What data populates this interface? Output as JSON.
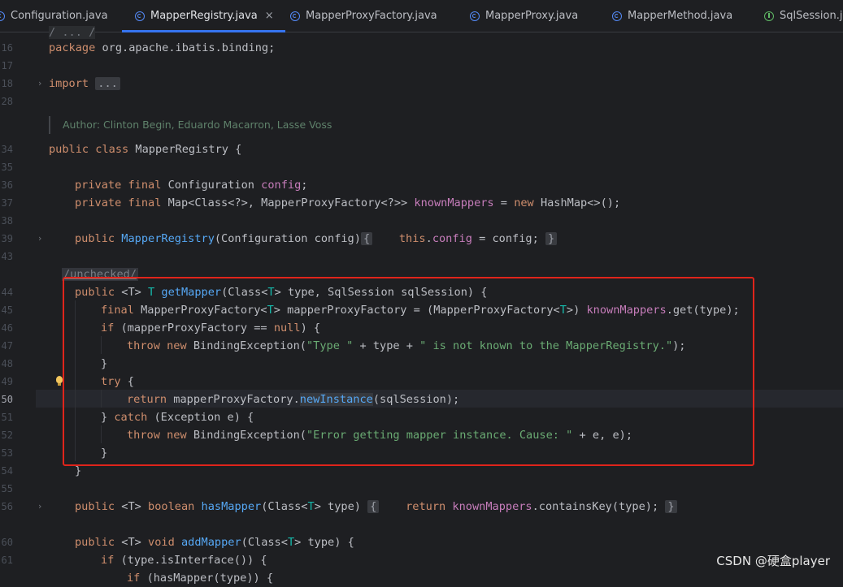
{
  "tabs": [
    {
      "label": "Configuration.java",
      "icon": "java-class-icon",
      "active": false
    },
    {
      "label": "MapperRegistry.java",
      "icon": "java-class-icon",
      "active": true,
      "close": "×"
    },
    {
      "label": "MapperProxyFactory.java",
      "icon": "java-class-icon",
      "active": false
    },
    {
      "label": "MapperProxy.java",
      "icon": "java-class-icon",
      "active": false
    },
    {
      "label": "MapperMethod.java",
      "icon": "java-class-icon",
      "active": false
    },
    {
      "label": "SqlSession.ja",
      "icon": "java-interface-icon",
      "active": false
    }
  ],
  "gutter": {
    "line_numbers": [
      "16",
      "17",
      "18",
      "28",
      "34",
      "35",
      "36",
      "37",
      "38",
      "39",
      "43",
      "44",
      "45",
      "46",
      "47",
      "48",
      "49",
      "50",
      "51",
      "52",
      "53",
      "54",
      "55",
      "56",
      "60",
      "61"
    ],
    "current_line": "50"
  },
  "code": {
    "package_kw": "package",
    "package_name": " org.apache.ibatis.binding;",
    "import_kw": "import",
    "import_fold": "...",
    "doc_author": "Author: Clinton Begin, Eduardo Macarron, Lasse Voss",
    "class_decl": [
      "public class ",
      "MapperRegistry {"
    ],
    "config_field": [
      "private final ",
      "Configuration ",
      "config",
      ";"
    ],
    "known_mappers_field": [
      "private final ",
      "Map<Class<?>, MapperProxyFactory<?>> ",
      "knownMappers",
      " = ",
      "new ",
      "HashMap<>();"
    ],
    "constructor": [
      "public ",
      "MapperRegistry",
      "(Configuration config)",
      "{",
      "this",
      ".",
      "config",
      " = config;",
      "}"
    ],
    "suppress": "/unchecked/",
    "get_mapper_sig": [
      "public ",
      "<T> ",
      "T ",
      "getMapper",
      "(Class<",
      "T",
      "> type, SqlSession sqlSession) {"
    ],
    "final_factory": [
      "final ",
      "MapperProxyFactory<",
      "T",
      "> mapperProxyFactory = (MapperProxyFactory<",
      "T",
      ">) ",
      "knownMappers",
      ".get(type);"
    ],
    "if_null": [
      "if ",
      "(mapperProxyFactory == ",
      "null",
      ") {"
    ],
    "throw_unknown": [
      "throw new ",
      "BindingException(",
      "\"Type \"",
      " + type + ",
      "\" is not known to the MapperRegistry.\"",
      ");"
    ],
    "close1": "}",
    "try": [
      "try ",
      "{"
    ],
    "return_new": [
      "return ",
      "mapperProxyFactory.",
      "newInstance",
      "(sqlSession);"
    ],
    "catch": [
      "} ",
      "catch ",
      "(Exception e) {"
    ],
    "throw_error": [
      "throw new ",
      "BindingException(",
      "\"Error getting mapper instance. Cause: \"",
      " + e, e);"
    ],
    "close2": "}",
    "close3": "}",
    "has_mapper": [
      "public ",
      "<T> ",
      "boolean ",
      "hasMapper",
      "(Class<",
      "T",
      "> type)",
      "{",
      "return ",
      "knownMappers",
      ".containsKey(type);",
      "}"
    ],
    "add_mapper": [
      "public ",
      "<T> ",
      "void ",
      "addMapper",
      "(Class<",
      "T",
      "> type) {"
    ],
    "if_interface": [
      "if ",
      "(type.isInterface()) {"
    ],
    "partial_top": "/ ... /",
    "partial_bottom": [
      "if ",
      "(hasMapper(type)) {"
    ]
  },
  "watermark": "CSDN @硬盒player",
  "colors": {
    "keyword": "#cf8e6d",
    "method": "#56a8f5",
    "field": "#c77dbb",
    "string": "#6aab73",
    "highlight_box": "#e0241b"
  }
}
